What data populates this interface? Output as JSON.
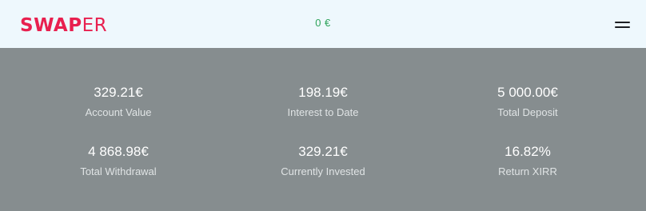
{
  "header": {
    "logo_bold": "SWAP",
    "logo_light": "ER",
    "balance": "0 €",
    "menu_icon": "hamburger-menu-icon"
  },
  "stats": [
    {
      "value": "329.21€",
      "label": "Account Value"
    },
    {
      "value": "198.19€",
      "label": "Interest to Date"
    },
    {
      "value": "5 000.00€",
      "label": "Total Deposit"
    },
    {
      "value": "4 868.98€",
      "label": "Total Withdrawal"
    },
    {
      "value": "329.21€",
      "label": "Currently Invested"
    },
    {
      "value": "16.82%",
      "label": "Return XIRR"
    }
  ],
  "colors": {
    "brand": "#e8204f",
    "header_bg": "#eef8fd",
    "balance": "#2ea35b",
    "panel_bg": "#868d8f"
  }
}
